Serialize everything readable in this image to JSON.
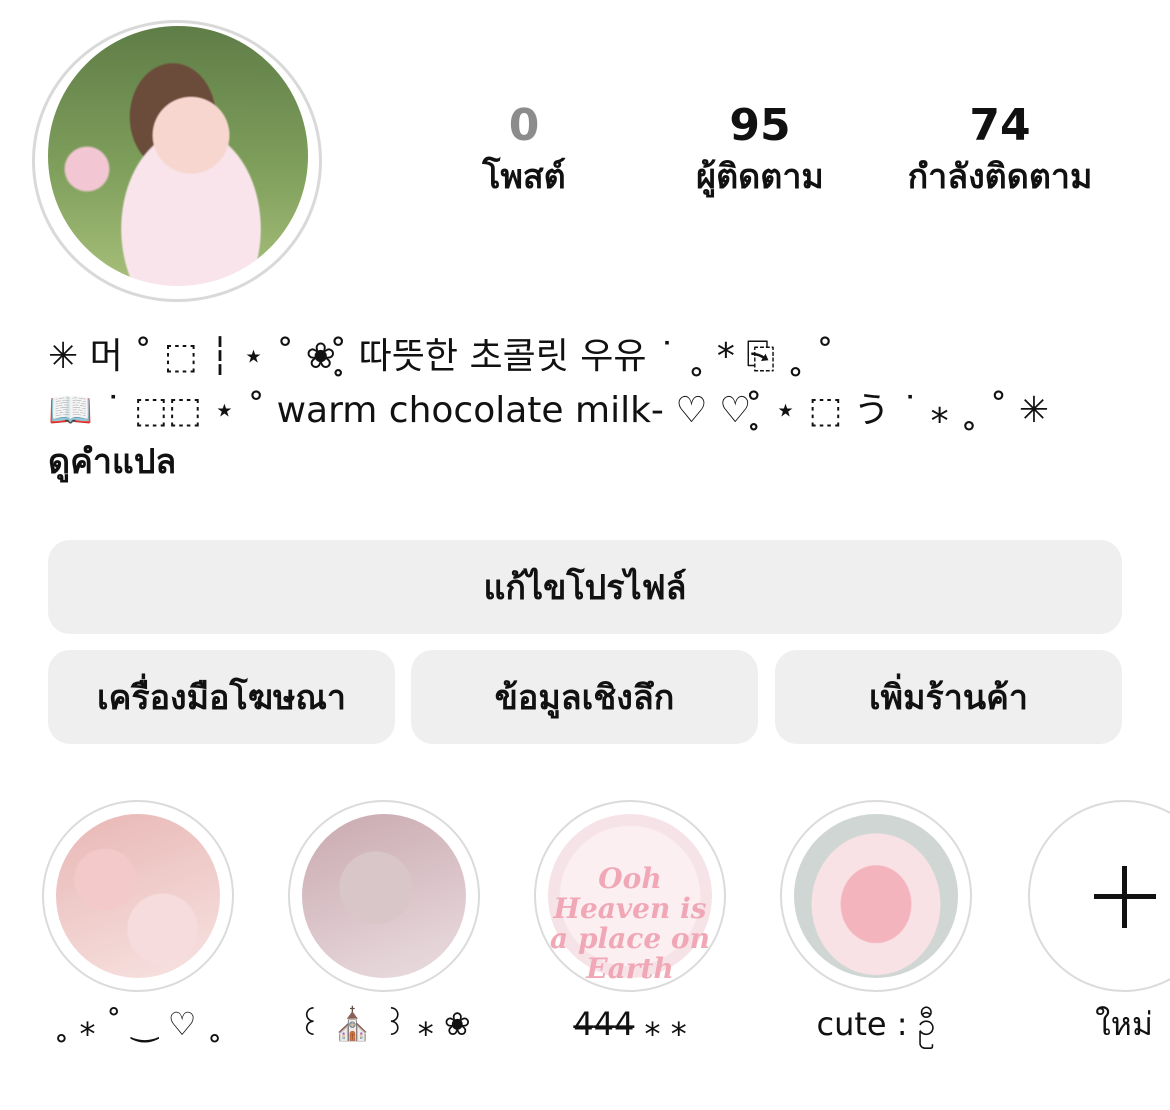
{
  "profile": {
    "stats": {
      "posts": {
        "value": "0",
        "label": "โพสต์"
      },
      "followers": {
        "value": "95",
        "label": "ผู้ติดตาม"
      },
      "following": {
        "value": "74",
        "label": "กำลังติดตาม"
      }
    },
    "bio": {
      "line1": "✳ 머 ˚ ⬚ ┆ ⋆ ˚ ❀ ̥̊ 따뜻한 초콜릿 우유 ˙ ˳ * ⎘ ˳ ˚",
      "line2": "📖 ˙ ⬚⬚ ⋆ ˚ warm chocolate milk- ♡ ♡ ̥̊ ⋆ ⬚ う ˙ ⁎ ˳ ˚ ✳",
      "translate": "ดูคำแปล"
    }
  },
  "buttons": {
    "edit_profile": "แก้ไขโปรไฟล์",
    "ad_tools": "เครื่องมือโฆษณา",
    "insights": "ข้อมูลเชิงลึก",
    "add_shop": "เพิ่มร้านค้า"
  },
  "highlights": [
    {
      "label": "˳ ⁎ ˚ ‿ ♡ ˳",
      "icon": "highlight-cosmetics"
    },
    {
      "label": "꒰ ⛪ ꒱ ⁎ ❀",
      "icon": "highlight-lace-book"
    },
    {
      "label": "4̶4̶4̶ ⁎ ⁎",
      "icon": "highlight-heaven-text",
      "image_text": "Ooh Heaven is a place on Earth"
    },
    {
      "label": "cute : ဦ",
      "icon": "highlight-ice-cream"
    },
    {
      "label": "ใหม่",
      "icon": "plus-icon"
    }
  ]
}
